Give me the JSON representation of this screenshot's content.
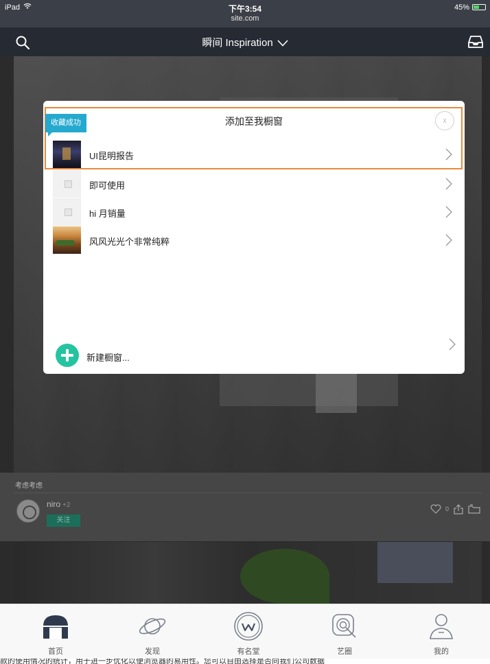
{
  "statusbar": {
    "carrier": "iPad",
    "time": "下午3:54",
    "url": "site.com",
    "battery_text": "45%",
    "battery_level": 0.45,
    "battery_color": "#4cd964"
  },
  "navbar": {
    "title": "瞬间 Inspiration",
    "left_icon": "search-icon",
    "right_icon": "inbox-icon",
    "background": "#262b33"
  },
  "feed": {
    "caption": "考虑考虑",
    "user": {
      "name": "niro",
      "extra": "+2",
      "follow_label": "关注"
    },
    "like_count": "0"
  },
  "modal": {
    "title": "添加至我橱窗",
    "close_label": "x",
    "badge": "收藏成功",
    "highlight_color": "#e8893b",
    "badge_color": "#25a9cf",
    "items": [
      {
        "label": "UI昆明报告",
        "thumb": "dark-room-photo"
      },
      {
        "label": "即可使用",
        "thumb": "placeholder-image"
      },
      {
        "label": "hi 月销量",
        "thumb": "placeholder-image"
      },
      {
        "label": "风风光光个非常纯粹",
        "thumb": "food-photo"
      }
    ],
    "new_label": "新建橱窗...",
    "accent": "#25c4a0"
  },
  "tabbar": {
    "tabs": [
      {
        "label": "首页",
        "icon": "home-icon"
      },
      {
        "label": "发现",
        "icon": "planet-icon"
      },
      {
        "label": "有名堂",
        "icon": "w-logo-icon"
      },
      {
        "label": "艺圈",
        "icon": "target-icon"
      },
      {
        "label": "我的",
        "icon": "profile-icon"
      }
    ]
  },
  "footer_text": "款的使用情况的统计，用于进一步优化以便浏览器的易用性。您可以自由选择是否向我们公司数据"
}
